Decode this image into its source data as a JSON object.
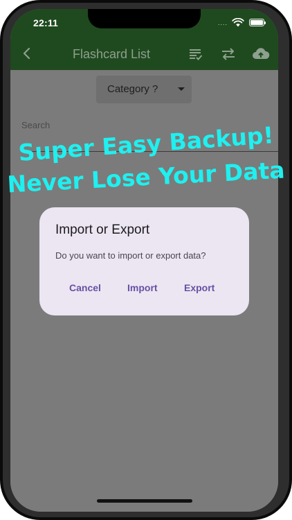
{
  "status": {
    "time": "22:11",
    "dots": "...."
  },
  "appbar": {
    "title": "Flashcard List"
  },
  "filter": {
    "category_label": "Category ?"
  },
  "search": {
    "label": "Search"
  },
  "promo": {
    "line1": "Super Easy Backup!",
    "line2": "Never Lose Your Data"
  },
  "dialog": {
    "title": "Import or Export",
    "message": "Do you want to import or export data?",
    "cancel": "Cancel",
    "import": "Import",
    "export": "Export"
  },
  "colors": {
    "appbar": "#1f4a1f",
    "scrim": "#7b7b7b",
    "dialog_bg": "#ece6f2",
    "accent": "#6750a4",
    "promo": "#1ff0f0"
  },
  "icons": [
    "back-arrow-icon",
    "checklist-icon",
    "swap-arrows-icon",
    "cloud-upload-icon",
    "wifi-icon",
    "battery-icon"
  ]
}
